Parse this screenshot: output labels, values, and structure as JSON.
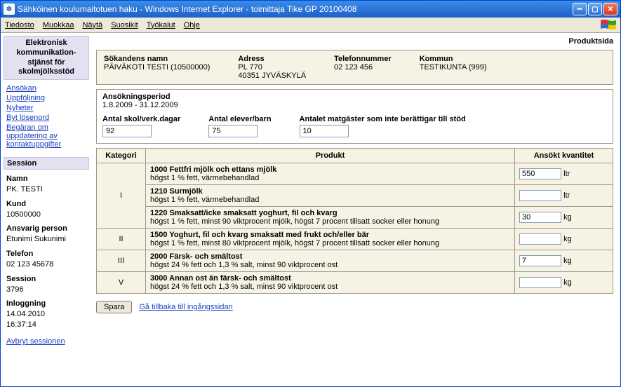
{
  "window": {
    "title": "Sähköinen koulumaitotuen haku - Windows Internet Explorer - toimittaja Tike GP 20100408"
  },
  "menu": {
    "file": "Tiedosto",
    "edit": "Muokkaa",
    "view": "Näytä",
    "fav": "Suosikit",
    "tools": "Työkalut",
    "help": "Ohje"
  },
  "page_label": "Produktsida",
  "sidebar": {
    "title": "Elektronisk kommunikation-stjänst för skolmjölksstöd",
    "nav": [
      "Ansökan",
      "Uppföljning",
      "Nyheter",
      "Byt lösenord",
      "Begäran om uppdatering av kontaktuppgifter"
    ],
    "session_hdr": "Session",
    "session": {
      "name_lbl": "Namn",
      "name": "PK. TESTI",
      "kund_lbl": "Kund",
      "kund": "10500000",
      "ansvarig_lbl": "Ansvarig person",
      "ansvarig": "Etunimi Sukunimi",
      "tel_lbl": "Telefon",
      "tel": "02 123 45678",
      "sess_lbl": "Session",
      "sess": "3796",
      "login_lbl": "Inloggning",
      "login_date": "14.04.2010",
      "login_time": "16:37:14"
    },
    "avbryt": "Avbryt sessionen"
  },
  "applicant": {
    "name_lbl": "Sökandens namn",
    "name": "PÄIVÄKOTI TESTI (10500000)",
    "adr_lbl": "Adress",
    "adr1": "PL 770",
    "adr2": "40351 JYVÄSKYLÄ",
    "tel_lbl": "Telefonnummer",
    "tel": "02 123 456",
    "komm_lbl": "Kommun",
    "komm": "TESTIKUNTA (999)"
  },
  "period": {
    "hdr": "Ansökningsperiod",
    "range": "1.8.2009 - 31.12.2009",
    "days_lbl": "Antal skol/verk.dagar",
    "days": "92",
    "pupils_lbl": "Antal elever/barn",
    "pupils": "75",
    "guests_lbl": "Antalet matgäster som inte berättigar till stöd",
    "guests": "10"
  },
  "table": {
    "th_cat": "Kategori",
    "th_prod": "Produkt",
    "th_qty": "Ansökt kvantitet",
    "cats": [
      "I",
      "II",
      "III",
      "V"
    ],
    "rows": [
      {
        "code": "1000",
        "name": "Fettfri mjölk och ettans mjölk",
        "desc": "högst 1 % fett, värmebehandlad",
        "qty": "550",
        "unit": "ltr"
      },
      {
        "code": "1210",
        "name": "Surmjölk",
        "desc": "högst 1 % fett, värmebehandlad",
        "qty": "",
        "unit": "ltr"
      },
      {
        "code": "1220",
        "name": "Smaksatt/icke smaksatt yoghurt, fil och kvarg",
        "desc": "högst 1 % fett, minst 90 viktprocent mjölk, högst 7 procent tillsatt socker eller honung",
        "qty": "30",
        "unit": "kg"
      },
      {
        "code": "1500",
        "name": "Yoghurt, fil och kvarg smaksatt med frukt och/eller bär",
        "desc": "högst 1 % fett, minst 80 viktprocent mjölk, högst 7 procent tillsatt socker eller honung",
        "qty": "",
        "unit": "kg"
      },
      {
        "code": "2000",
        "name": "Färsk- och smältost",
        "desc": "högst 24 % fett och 1,3 % salt, minst 90 viktprocent ost",
        "qty": "7",
        "unit": "kg"
      },
      {
        "code": "3000",
        "name": "Annan ost än färsk- och smältost",
        "desc": "högst 24 % fett och 1,3 % salt, minst 90 viktprocent ost",
        "qty": "",
        "unit": "kg"
      }
    ]
  },
  "actions": {
    "save": "Spara",
    "back": "Gå tillbaka till ingångssidan"
  }
}
